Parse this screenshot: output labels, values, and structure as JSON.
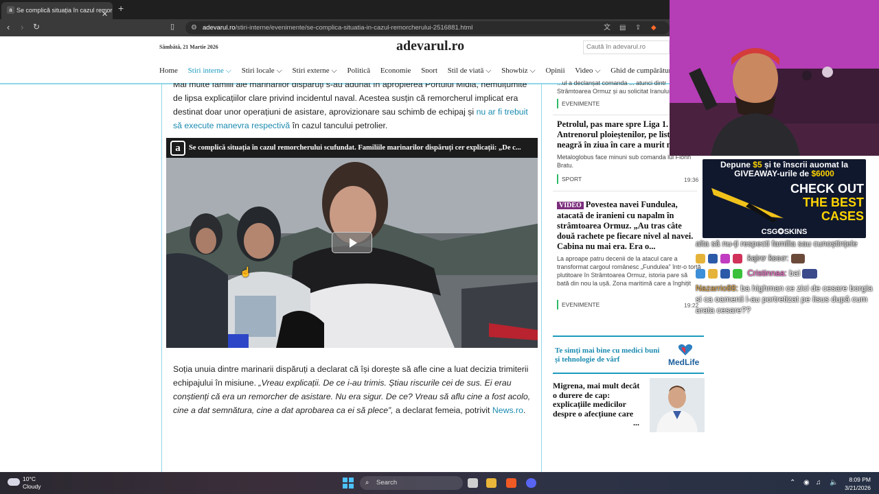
{
  "browser": {
    "tab_title": "Se complică situația în cazul remorcherului",
    "tab_favicon": "a",
    "new_tab": "+",
    "url_host": "adevarul.ro",
    "url_path": "/stiri-interne/evenimente/se-complica-situatia-in-cazul-remorcherului-2516881.html",
    "icons": [
      "back-icon",
      "forward-icon",
      "reload-icon",
      "bookmark-icon",
      "site-info-icon",
      "translate-icon",
      "reader-icon",
      "share-icon",
      "brave-shield-icon"
    ]
  },
  "site": {
    "date": "Sâmbătă, 21 Martie 2026",
    "logo": "adevarul.ro",
    "search_placeholder": "Caută în adevarul.ro",
    "nav": [
      "Home",
      "Știri interne",
      "Știri locale",
      "Știri externe",
      "Politică",
      "Economie",
      "Sport",
      "Stil de viață",
      "Showbiz",
      "Opinii",
      "Video",
      "Ghid de cumpărături"
    ],
    "nav_active": "Știri interne"
  },
  "article": {
    "p1_partial": "Mai multe familii ale marinarilor dispăruți s-au adunat în apropierea Portului Midia, nemulțumite de lipsa explicațiilor clare privind incidentul naval. Acestea susțin că remorcherul implicat era destinat doar unor operațiuni de asistare, aprovizionare sau schimb de echipaj și",
    "p1_link": "nu ar fi trebuit să execute manevra respectivă",
    "p1_end": "în cazul tancului petrolier.",
    "video_title": "Se complică situația în cazul remorcherului scufundat. Familiile marinarilor dispăruți cer explicații: „De c...",
    "p2_start": "Soția unuia dintre marinarii dispăruți a declarat că își dorește să afle cine a luat decizia trimiterii echipajului în misiune.",
    "p2_quote": "„Vreau explicații. De ce i-au trimis. Știau riscurile cei de sus. Ei erau conștienți că era un remorcher de asistare. Nu era sigur. De ce? Vreau să aflu cine a fost acolo, cine a dat semnătura, cine a dat aprobarea ca ei să plece”,",
    "p2_end": "a declarat femeia, potrivit",
    "p2_link": "News.ro",
    "p2_dot": "."
  },
  "sidebar": {
    "top_partial_1": "...ul a declanșat comanda ... atunci dintr",
    "top_partial_2": "Strâmtoarea Ormuz și au solicitat Iranului",
    "top_cat": "EVENIMENTE",
    "item2": {
      "title": "Petrolul, pas mare spre Liga 1. Antrenorul ploieștenilor, pe lista neagră în ziua în care a murit mama lui",
      "body": "Metaloglobus face minuni sub comanda lui Florin Bratu.",
      "category": "SPORT",
      "time": "19:36"
    },
    "item3": {
      "badge": "VIDEO",
      "title": "Povestea navei Fundulea, atacată de iranieni cu napalm în strâmtoarea Ormuz. „Au tras câte două rachete pe fiecare nivel al navei. Cabina nu mai era. Era o...",
      "body": "La aproape patru decenii de la atacul care a transformat cargoul românesc „Fundulea” într-o torță plutitoare în Strâmtoarea Ormuz, istoria pare să bată din nou la ușă. Zona maritimă care a înghițit atunci vieți este astăzi din nou în centru",
      "category": "EVENIMENTE",
      "time": "19:22"
    },
    "medlife_text": "Te simți mai bine cu medici buni și tehnologie de vârf",
    "medlife_logo": "MedLife",
    "migrena": "Migrena, mai mult decât o durere de cap: explicațiile medicilor despre o afecțiune care afectează milioane d...",
    "migrena_more": "..."
  },
  "stream": {
    "promo_line1a": "Depune ",
    "promo_amount1": "$5",
    "promo_line1b": " și te înscrii auomat la",
    "promo_line2a": "GIVEAWAY-urile de ",
    "promo_amount2": "$6000",
    "promo_big1": "CHECK OUT",
    "promo_big2": "THE BEST",
    "promo_big3": "CASES",
    "promo_brand": "CSG✪SKINS",
    "chat": {
      "line1": "alta să nu-ți respecti familia sau cunoștințele",
      "line2_user": "ƙąɨɾơ ƙɛɢơ:",
      "line3_user": "Cristinnaa:",
      "line3_msg": "bai",
      "line4_user": "Nazarrio88:",
      "line4_msg": "ba highman ce zici de cesare borgia si ca oamenii l-au portretizat pe iisus după cum arata cesare??"
    }
  },
  "taskbar": {
    "temp": "10°C",
    "condition": "Cloudy",
    "search": "Search",
    "time": "8:09 PM",
    "date": "3/21/2026"
  }
}
